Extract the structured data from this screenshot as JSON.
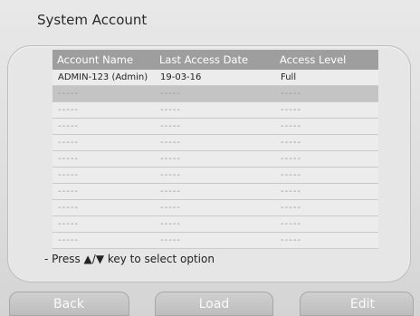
{
  "title": "System Account",
  "table": {
    "headers": [
      "Account Name",
      "Last Access Date",
      "Access Level"
    ],
    "rows": [
      [
        "ADMIN-123 (Admin)",
        "19-03-16",
        "Full"
      ],
      [
        "-----",
        "-----",
        "-----"
      ],
      [
        "-----",
        "-----",
        "-----"
      ],
      [
        "-----",
        "-----",
        "-----"
      ],
      [
        "-----",
        "-----",
        "-----"
      ],
      [
        "-----",
        "-----",
        "-----"
      ],
      [
        "-----",
        "-----",
        "-----"
      ],
      [
        "-----",
        "-----",
        "-----"
      ],
      [
        "-----",
        "-----",
        "-----"
      ],
      [
        "-----",
        "-----",
        "-----"
      ],
      [
        "-----",
        "-----",
        "-----"
      ]
    ],
    "selected_row": 1
  },
  "hint": "- Press ▲/▼ key to select option",
  "buttons": {
    "back": "Back",
    "load": "Load",
    "edit": "Edit"
  }
}
